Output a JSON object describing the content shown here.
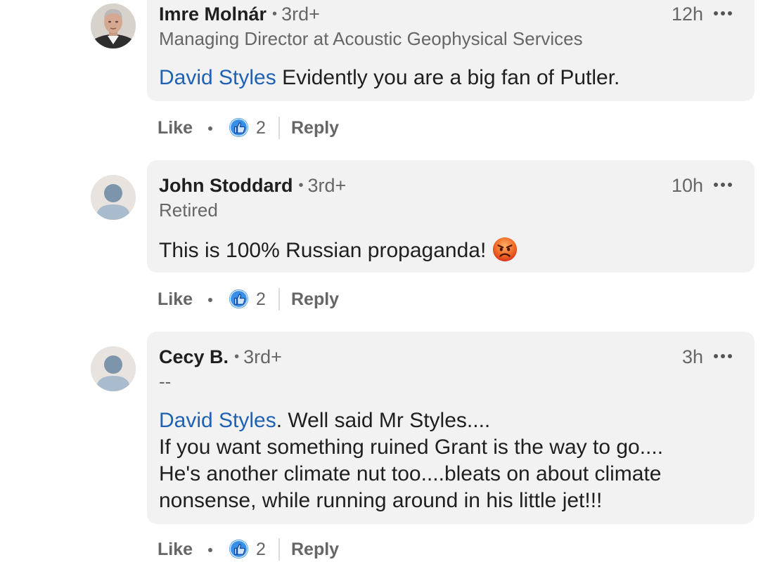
{
  "actions": {
    "like_label": "Like",
    "reply_label": "Reply"
  },
  "comments": [
    {
      "name": "Imre Molnár",
      "degree": "3rd+",
      "time": "12h",
      "headline": "Managing Director at Acoustic Geophysical Services",
      "mention": "David Styles",
      "text": " Evidently you are a big fan of Putler.",
      "reactions": "2"
    },
    {
      "name": "John Stoddard",
      "degree": "3rd+",
      "time": "10h",
      "headline": "Retired",
      "text": "This is 100% Russian propaganda!",
      "emoji": "angry-face-emoji",
      "reactions": "2"
    },
    {
      "name": "Cecy B.",
      "degree": "3rd+",
      "time": "3h",
      "headline": "--",
      "mention": "David Styles",
      "text_line1": ".  Well said Mr Styles....",
      "text_line2": "If you want something ruined Grant is the way to go....",
      "text_line3": "He's another climate nut too....bleats on about climate",
      "text_line4": "nonsense,  while running around in his little jet!!!",
      "reactions": "2"
    }
  ],
  "colors": {
    "mention": "#1f62b4",
    "bubble": "#f2f2f2",
    "like_icon": "#378fe9"
  },
  "icons": [
    "more-options-icon",
    "like-reaction-icon",
    "default-avatar-icon"
  ]
}
